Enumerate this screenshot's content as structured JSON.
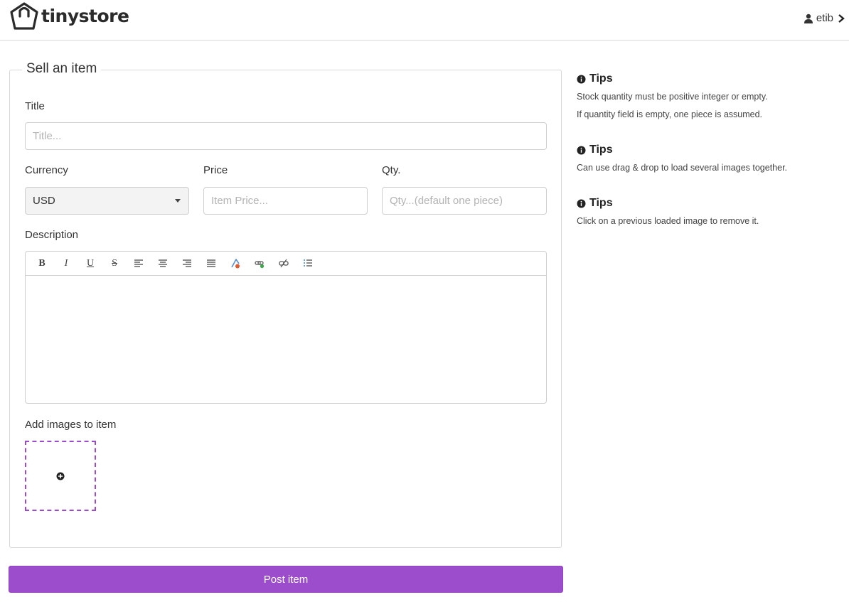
{
  "header": {
    "logo_text": "tinystore",
    "user_name": "etib"
  },
  "form": {
    "legend": "Sell an item",
    "title": {
      "label": "Title",
      "placeholder": "Title..."
    },
    "currency": {
      "label": "Currency",
      "value": "USD"
    },
    "price": {
      "label": "Price",
      "placeholder": "Item Price..."
    },
    "qty": {
      "label": "Qty.",
      "placeholder": "Qty...(default one piece)"
    },
    "description": {
      "label": "Description"
    },
    "toolbar": {
      "bold": "B",
      "italic": "I",
      "underline": "U",
      "strike": "S"
    },
    "images": {
      "label": "Add images to item"
    },
    "post_label": "Post item"
  },
  "tips": [
    {
      "title": "Tips",
      "lines": [
        "Stock quantity must be positive integer or empty.",
        "If quantity field is empty, one piece is assumed."
      ]
    },
    {
      "title": "Tips",
      "lines": [
        "Can use drag & drop to load several images together."
      ]
    },
    {
      "title": "Tips",
      "lines": [
        "Click on a previous loaded image to remove it."
      ]
    }
  ],
  "colors": {
    "accent": "#9c4dcc",
    "border": "#cfcfcf"
  }
}
